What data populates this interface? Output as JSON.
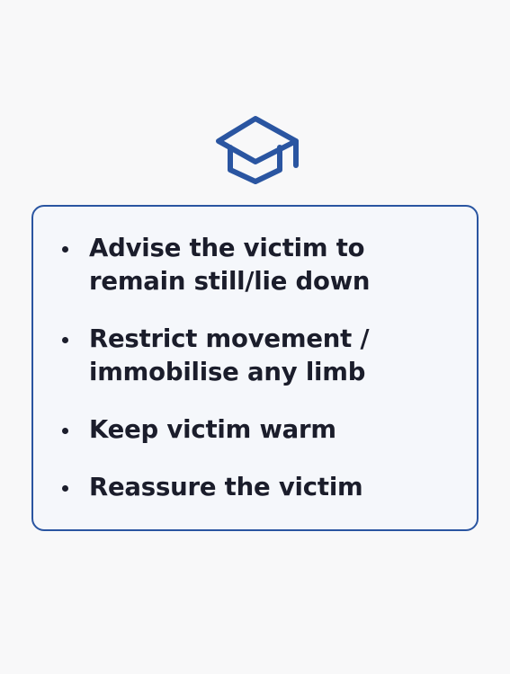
{
  "icon": {
    "name": "graduation-cap-icon",
    "color": "#2a55a1"
  },
  "card": {
    "border_color": "#2a55a1",
    "items": [
      {
        "text": "Advise the victim to remain still/lie down"
      },
      {
        "text": "Restrict movement / immobilise any limb"
      },
      {
        "text": "Keep victim warm"
      },
      {
        "text": "Reassure the victim"
      }
    ]
  }
}
